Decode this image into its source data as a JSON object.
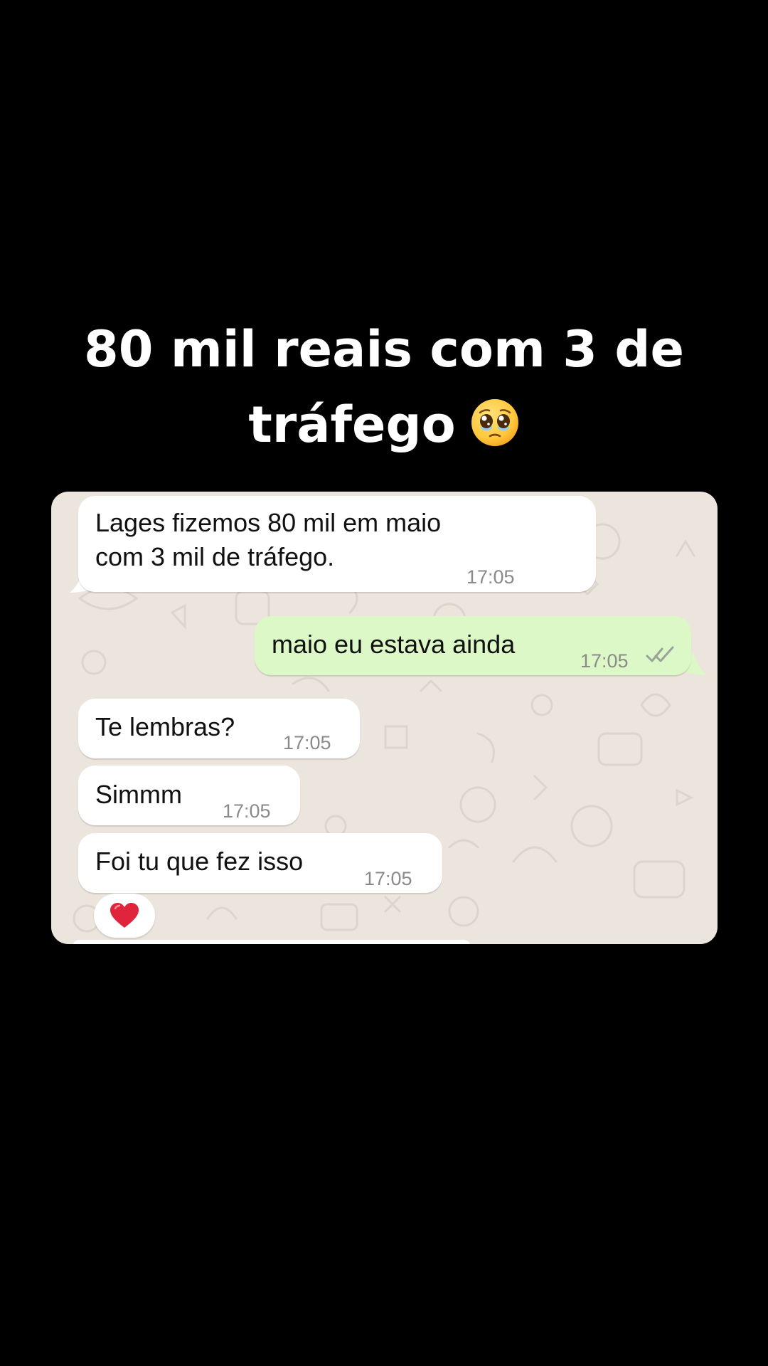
{
  "headline": {
    "line1": "80 mil reais com 3 de",
    "line2": "tráfego",
    "emoji": "pleading-face-emoji"
  },
  "messages": [
    {
      "direction": "incoming",
      "text_line1": "Lages fizemos 80 mil em maio",
      "text_line2": "com 3 mil de tráfego.",
      "time": "17:05"
    },
    {
      "direction": "outgoing",
      "text": "maio eu estava ainda",
      "time": "17:05",
      "status": "read-double-check-icon"
    },
    {
      "direction": "incoming",
      "text": "Te lembras?",
      "time": "17:05"
    },
    {
      "direction": "incoming",
      "text": "Simmm",
      "time": "17:05"
    },
    {
      "direction": "incoming",
      "text": "Foi tu que fez isso",
      "time": "17:05",
      "reaction": "red-heart-emoji"
    }
  ],
  "colors": {
    "background": "#000000",
    "chat_wallpaper": "#ECE5DD",
    "incoming_bubble": "#FFFFFF",
    "outgoing_bubble": "#DCF8C6",
    "timestamp": "#8A8A8A",
    "heart": "#E0243B"
  }
}
